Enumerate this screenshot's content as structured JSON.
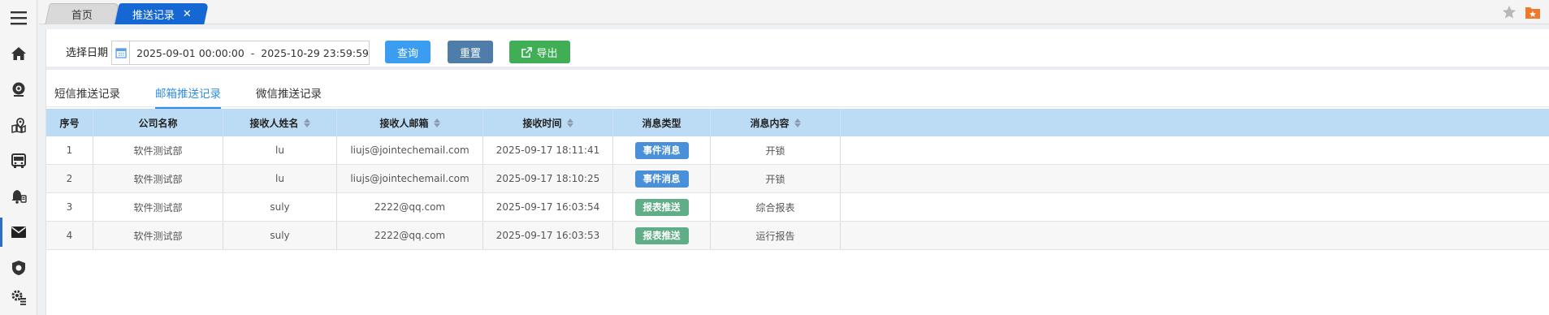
{
  "sidebar": {
    "items": [
      {
        "icon": "menu-icon"
      },
      {
        "icon": "home-icon"
      },
      {
        "icon": "camera-icon"
      },
      {
        "icon": "map-pin-icon"
      },
      {
        "icon": "bus-icon"
      },
      {
        "icon": "alarm-icon"
      },
      {
        "icon": "mail-icon",
        "active": true
      },
      {
        "icon": "shield-icon"
      },
      {
        "icon": "gear-list-icon"
      }
    ]
  },
  "tabs": {
    "home": "首页",
    "active": "推送记录",
    "close": "✕"
  },
  "filter": {
    "label": "选择日期",
    "date_range": "2025-09-01 00:00:00  -  2025-10-29 23:59:59",
    "query_label": "查询",
    "reset_label": "重置",
    "export_label": "导出"
  },
  "subtabs": [
    "短信推送记录",
    "邮箱推送记录",
    "微信推送记录"
  ],
  "table": {
    "headers": [
      "序号",
      "公司名称",
      "接收人姓名",
      "接收人邮箱",
      "接收时间",
      "消息类型",
      "消息内容"
    ],
    "rows": [
      {
        "no": "1",
        "company": "软件测试部",
        "name": "lu",
        "email": "liujs@jointechemail.com",
        "time": "2025-09-17 18:11:41",
        "type": "事件消息",
        "content": "开锁"
      },
      {
        "no": "2",
        "company": "软件测试部",
        "name": "lu",
        "email": "liujs@jointechemail.com",
        "time": "2025-09-17 18:10:25",
        "type": "事件消息",
        "content": "开锁"
      },
      {
        "no": "3",
        "company": "软件测试部",
        "name": "suly",
        "email": "2222@qq.com",
        "time": "2025-09-17 16:03:54",
        "type": "报表推送",
        "content": "综合报表"
      },
      {
        "no": "4",
        "company": "软件测试部",
        "name": "suly",
        "email": "2222@qq.com",
        "time": "2025-09-17 16:03:53",
        "type": "报表推送",
        "content": "运行报告"
      }
    ]
  },
  "colors": {
    "event_badge": "#4a90d9",
    "report_badge": "#5fae87",
    "active_tab": "#1567d3"
  }
}
